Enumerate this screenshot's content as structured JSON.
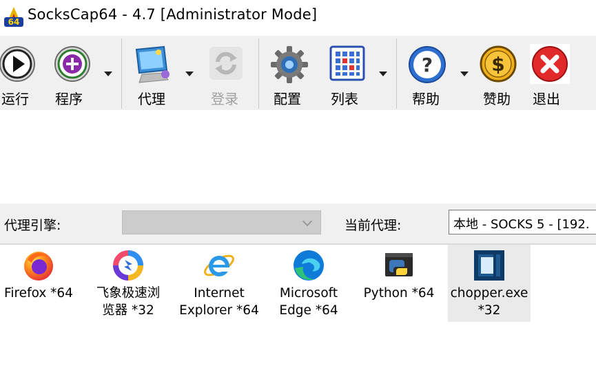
{
  "window": {
    "title": "SocksCap64 - 4.7 [Administrator Mode]",
    "logo_text": "64"
  },
  "toolbar": {
    "run": "运行",
    "programs": "程序",
    "proxy": "代理",
    "login": "登录",
    "config": "配置",
    "list": "列表",
    "help": "帮助",
    "sponsor": "赞助",
    "exit": "退出"
  },
  "proxybar": {
    "engine_label": "代理引擎:",
    "engine_value": "",
    "current_label": "当前代理:",
    "current_value": "本地 - SOCKS 5 - [192."
  },
  "apps": [
    {
      "line1": "Firefox *64",
      "line2": "",
      "icon": "firefox-icon"
    },
    {
      "line1": "飞象极速浏",
      "line2": "览器 *32",
      "icon": "feixiang-browser-icon"
    },
    {
      "line1": "Internet",
      "line2": "Explorer *64",
      "icon": "internet-explorer-icon"
    },
    {
      "line1": "Microsoft",
      "line2": "Edge *64",
      "icon": "edge-icon"
    },
    {
      "line1": "Python *64",
      "line2": "",
      "icon": "python-icon"
    },
    {
      "line1": "chopper.exe",
      "line2": "*32",
      "icon": "chopper-icon",
      "selected": true
    }
  ],
  "colors": {
    "toolbar_bg": "#f0f0f0",
    "selected_bg": "#eaeaea",
    "disabled_text": "#a0a0a0"
  }
}
